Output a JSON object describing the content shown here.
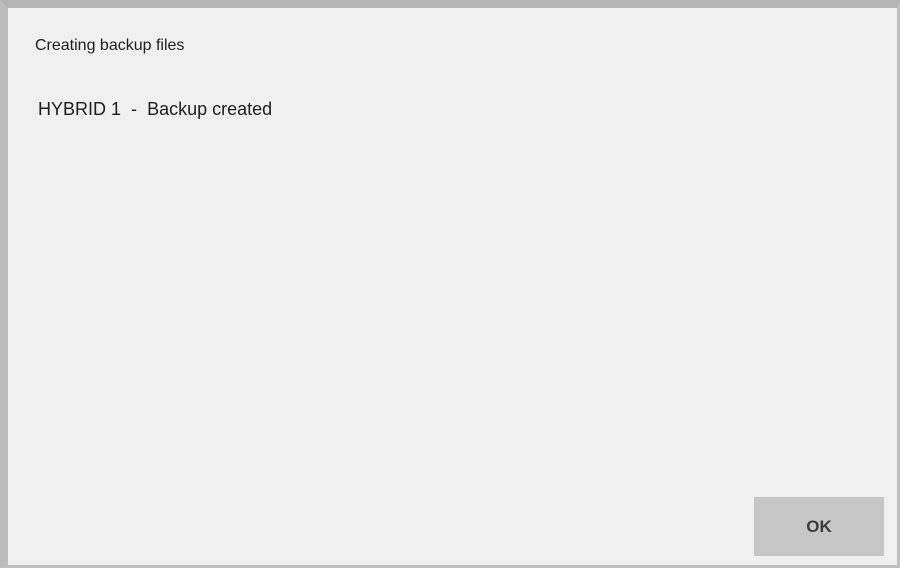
{
  "dialog": {
    "title": "Creating backup files",
    "status": {
      "device": "HYBRID 1",
      "separator": " - ",
      "message": "Backup created"
    },
    "ok_label": "OK"
  }
}
